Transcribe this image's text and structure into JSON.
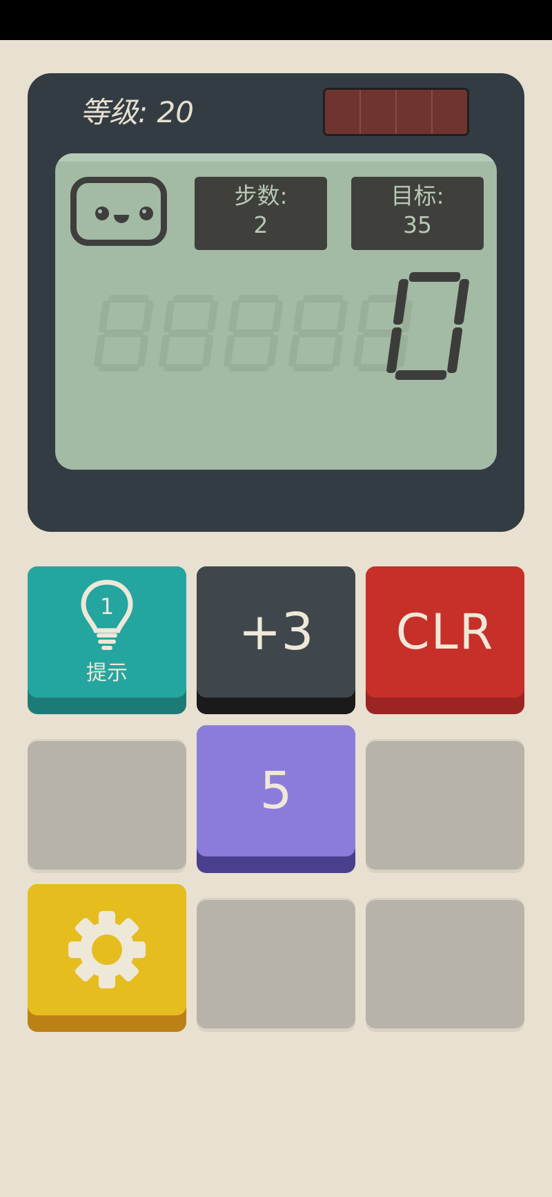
{
  "level": {
    "label": "等级: 20"
  },
  "screen": {
    "moves_label": "步数:",
    "moves_value": "2",
    "goal_label": "目标:",
    "goal_value": "35",
    "display_value": "0"
  },
  "keys": {
    "hint_number": "1",
    "hint_label": "提示",
    "plus_label": "+3",
    "clear_label": "CLR",
    "five_label": "5"
  },
  "colors": {
    "device": "#343c43",
    "screen": "#a3bba4",
    "hint_key": "#24a59f",
    "plus_key": "#40474c",
    "clear_key": "#c72f29",
    "five_key": "#8b7cdb",
    "settings_key": "#e6bd1f"
  }
}
